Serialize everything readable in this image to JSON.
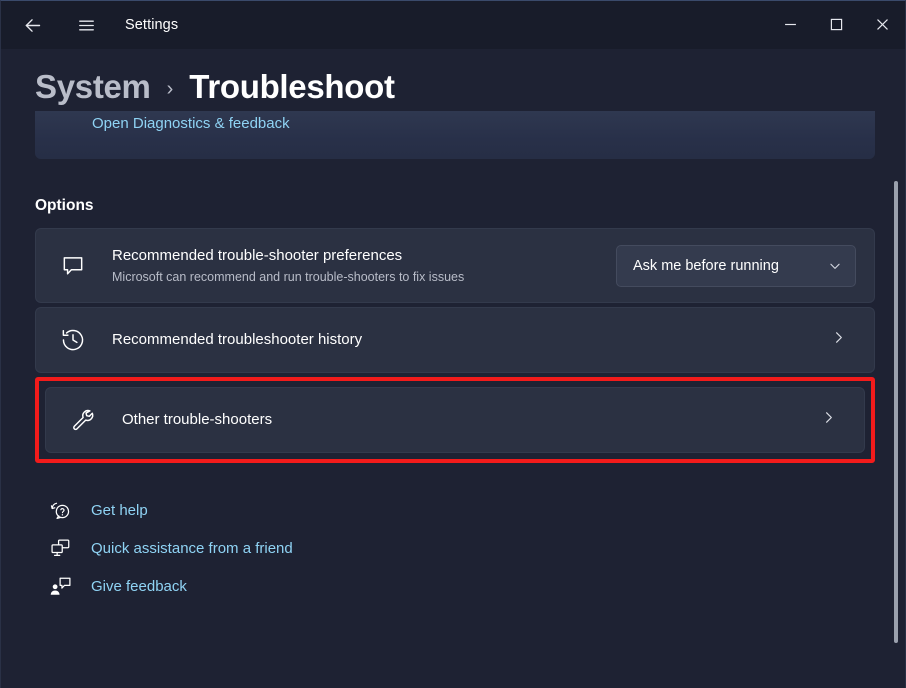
{
  "window": {
    "app_title": "Settings",
    "back_icon": "back-arrow-icon",
    "menu_icon": "hamburger-icon",
    "minimize_label": "—",
    "maximize_label": "□",
    "close_label": "✕"
  },
  "header": {
    "parent": "System",
    "separator": "›",
    "current": "Troubleshoot"
  },
  "top_card": {
    "link_label": "Open Diagnostics & feedback"
  },
  "options": {
    "section_title": "Options",
    "items": [
      {
        "icon": "chat-bubble-icon",
        "title": "Recommended trouble-shooter preferences",
        "subtitle": "Microsoft can recommend and run trouble-shooters to fix issues",
        "control": "dropdown",
        "dropdown_value": "Ask me before running"
      },
      {
        "icon": "history-clock-icon",
        "title": "Recommended troubleshooter history",
        "subtitle": "",
        "control": "chevron",
        "chevron": "›"
      },
      {
        "icon": "wrench-icon",
        "title": "Other trouble-shooters",
        "subtitle": "",
        "control": "chevron",
        "chevron": "›",
        "highlighted": true
      }
    ]
  },
  "footer": {
    "links": [
      {
        "icon": "help-bubble-icon",
        "label": "Get help"
      },
      {
        "icon": "quick-assist-icon",
        "label": "Quick assistance from a friend"
      },
      {
        "icon": "feedback-person-icon",
        "label": "Give feedback"
      }
    ]
  },
  "colors": {
    "page_bg": "#1e2233",
    "titlebar_bg": "#181c2a",
    "card_bg": "#2b3142",
    "accent_link": "#8fd3f4",
    "highlight_red": "#f21b1b",
    "subtext": "#b8bcc8"
  }
}
